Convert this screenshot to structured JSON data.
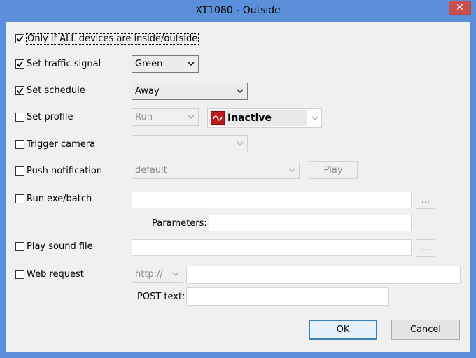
{
  "window": {
    "title": "XT1080 - Outside",
    "close_glyph": "✕"
  },
  "options": {
    "all_devices": {
      "label": "Only if ALL devices are inside/outside",
      "checked": true
    },
    "traffic": {
      "label": "Set traffic signal",
      "checked": true,
      "value": "Green"
    },
    "schedule": {
      "label": "Set schedule",
      "checked": true,
      "value": "Away"
    },
    "profile": {
      "label": "Set profile",
      "checked": false,
      "value": "Run",
      "profile_value": "Inactive",
      "profile_icon": "profile-icon"
    },
    "camera": {
      "label": "Trigger camera",
      "checked": false,
      "value": ""
    },
    "push": {
      "label": "Push notification",
      "checked": false,
      "value": "default",
      "play_label": "Play"
    },
    "exe": {
      "label": "Run exe/batch",
      "checked": false,
      "path": "",
      "browse_label": "...",
      "params_label": "Parameters:",
      "params_value": ""
    },
    "sound": {
      "label": "Play sound file",
      "checked": false,
      "path": "",
      "browse_label": "..."
    },
    "web": {
      "label": "Web request",
      "checked": false,
      "scheme": "http://",
      "url": "",
      "post_label": "POST text:",
      "post_value": ""
    }
  },
  "buttons": {
    "ok": "OK",
    "cancel": "Cancel"
  },
  "colors": {
    "frame": "#5b8fd9",
    "client": "#f0f0f0",
    "close": "#c7504f",
    "profile_icon": "#b81c1c"
  }
}
